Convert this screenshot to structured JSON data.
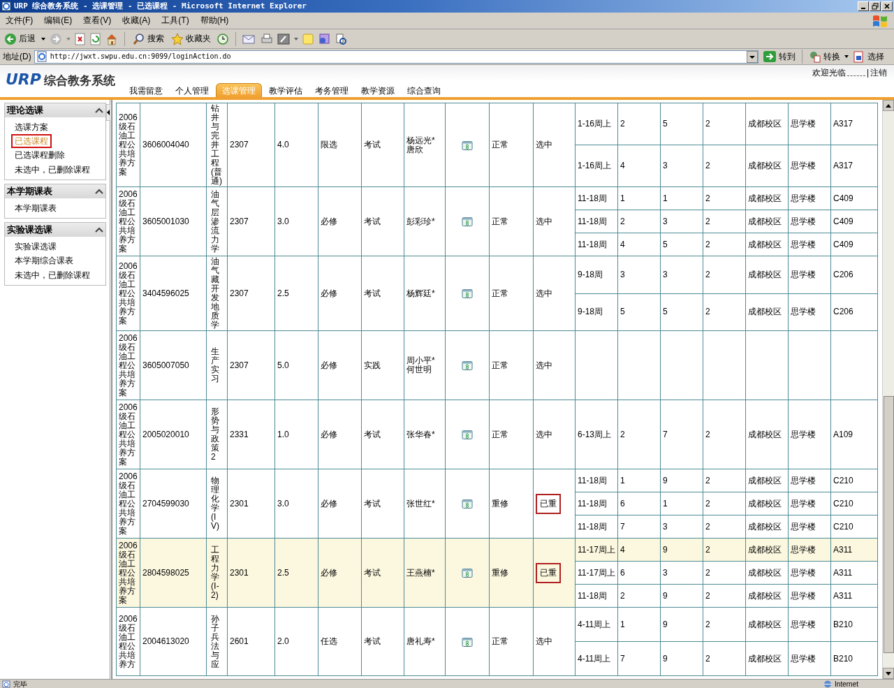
{
  "window": {
    "title": "URP 综合教务系统 - 选课管理 - 已选课程 - Microsoft Internet Explorer"
  },
  "menu": [
    "文件(F)",
    "编辑(E)",
    "查看(V)",
    "收藏(A)",
    "工具(T)",
    "帮助(H)"
  ],
  "toolbar": {
    "back": "后退",
    "search": "搜索",
    "favorites": "收藏夹"
  },
  "address_bar": {
    "label": "地址(D)",
    "url": "http://jwxt.swpu.edu.cn:9099/loginAction.do",
    "go": "转到",
    "convert": "转换",
    "select": "选择"
  },
  "header": {
    "logo_mark": "URP",
    "logo_text": "综合教务系统",
    "greeting": "欢迎光临",
    "separator": "|",
    "logout": "注销"
  },
  "tabs": [
    {
      "label": "我需留意",
      "selected": false
    },
    {
      "label": "个人管理",
      "selected": false
    },
    {
      "label": "选课管理",
      "selected": true
    },
    {
      "label": "教学评估",
      "selected": false
    },
    {
      "label": "考务管理",
      "selected": false
    },
    {
      "label": "教学资源",
      "selected": false
    },
    {
      "label": "综合查询",
      "selected": false
    }
  ],
  "sidebar": [
    {
      "title": "理论选课",
      "items": [
        {
          "label": "选课方案",
          "selected": false
        },
        {
          "label": "已选课程",
          "selected": true
        },
        {
          "label": "已选课程删除",
          "selected": false
        },
        {
          "label": "未选中，已删除课程",
          "selected": false
        }
      ]
    },
    {
      "title": "本学期课表",
      "items": [
        {
          "label": "本学期课表",
          "selected": false
        }
      ]
    },
    {
      "title": "实验课选课",
      "items": [
        {
          "label": "实验课选课",
          "selected": false
        },
        {
          "label": "本学期综合课表",
          "selected": false
        },
        {
          "label": "未选中，已删除课程",
          "selected": false
        }
      ]
    }
  ],
  "courses": [
    {
      "plan": "2006级石油工程公共培养方案",
      "code": "3606004040",
      "name": "钻井与完井工程(普通)",
      "group": "2307",
      "credit": "4.0",
      "type": "限选",
      "exam": "考试",
      "teachers": [
        "杨远光*",
        "唐欣"
      ],
      "status": "正常",
      "selection": "选中",
      "flagged": false,
      "highlighted": false,
      "sessions": [
        {
          "weeks": "1-16周上",
          "day": "2",
          "section": "5",
          "count": "2",
          "campus": "成都校区",
          "building": "思学楼",
          "room": "A317"
        },
        {
          "weeks": "1-16周上",
          "day": "4",
          "section": "3",
          "count": "2",
          "campus": "成都校区",
          "building": "思学楼",
          "room": "A317"
        }
      ]
    },
    {
      "plan": "2006级石油工程公共培养方案",
      "code": "3605001030",
      "name": "油气层渗流力学",
      "group": "2307",
      "credit": "3.0",
      "type": "必修",
      "exam": "考试",
      "teachers": [
        "彭彩珍*"
      ],
      "status": "正常",
      "selection": "选中",
      "flagged": false,
      "highlighted": false,
      "sessions": [
        {
          "weeks": "11-18周",
          "day": "1",
          "section": "1",
          "count": "2",
          "campus": "成都校区",
          "building": "思学楼",
          "room": "C409"
        },
        {
          "weeks": "11-18周",
          "day": "2",
          "section": "3",
          "count": "2",
          "campus": "成都校区",
          "building": "思学楼",
          "room": "C409"
        },
        {
          "weeks": "11-18周",
          "day": "4",
          "section": "5",
          "count": "2",
          "campus": "成都校区",
          "building": "思学楼",
          "room": "C409"
        }
      ]
    },
    {
      "plan": "2006级石油工程公共培养方案",
      "code": "3404596025",
      "name": "油气藏开发地质学",
      "group": "2307",
      "credit": "2.5",
      "type": "必修",
      "exam": "考试",
      "teachers": [
        "杨辉廷*"
      ],
      "status": "正常",
      "selection": "选中",
      "flagged": false,
      "highlighted": false,
      "sessions": [
        {
          "weeks": "9-18周",
          "day": "3",
          "section": "3",
          "count": "2",
          "campus": "成都校区",
          "building": "思学楼",
          "room": "C206"
        },
        {
          "weeks": "9-18周",
          "day": "5",
          "section": "5",
          "count": "2",
          "campus": "成都校区",
          "building": "思学楼",
          "room": "C206"
        }
      ]
    },
    {
      "plan": "2006级石油工程公共培养方案",
      "code": "3605007050",
      "name": "生产实习",
      "group": "2307",
      "credit": "5.0",
      "type": "必修",
      "exam": "实践",
      "teachers": [
        "周小平*",
        "何世明"
      ],
      "status": "正常",
      "selection": "选中",
      "flagged": false,
      "highlighted": false
    },
    {
      "plan": "2006级石油工程公共培养方案",
      "code": "2005020010",
      "name": "形势与政策2",
      "group": "2331",
      "credit": "1.0",
      "type": "必修",
      "exam": "考试",
      "teachers": [
        "张华春*"
      ],
      "status": "正常",
      "selection": "选中",
      "flagged": false,
      "highlighted": false,
      "sessions": [
        {
          "weeks": "6-13周上",
          "day": "2",
          "section": "7",
          "count": "2",
          "campus": "成都校区",
          "building": "思学楼",
          "room": "A109"
        }
      ]
    },
    {
      "plan": "2006级石油工程公共培养方案",
      "code": "2704599030",
      "name": "物理化学(IV)",
      "group": "2301",
      "credit": "3.0",
      "type": "必修",
      "exam": "考试",
      "teachers": [
        "张世红*"
      ],
      "status": "重修",
      "selection": "已重",
      "flagged": true,
      "highlighted": false,
      "sessions": [
        {
          "weeks": "11-18周",
          "day": "1",
          "section": "9",
          "count": "2",
          "campus": "成都校区",
          "building": "思学楼",
          "room": "C210"
        },
        {
          "weeks": "11-18周",
          "day": "6",
          "section": "1",
          "count": "2",
          "campus": "成都校区",
          "building": "思学楼",
          "room": "C210"
        },
        {
          "weeks": "11-18周",
          "day": "7",
          "section": "3",
          "count": "2",
          "campus": "成都校区",
          "building": "思学楼",
          "room": "C210"
        }
      ]
    },
    {
      "plan": "2006级石油工程公共培养方案",
      "code": "2804598025",
      "name": "工程力学(Ⅰ-2)",
      "group": "2301",
      "credit": "2.5",
      "type": "必修",
      "exam": "考试",
      "teachers": [
        "王燕楠*"
      ],
      "status": "重修",
      "selection": "已重",
      "flagged": true,
      "highlighted": true,
      "sessions": [
        {
          "weeks": "11-17周上",
          "day": "4",
          "section": "9",
          "count": "2",
          "campus": "成都校区",
          "building": "思学楼",
          "room": "A311"
        },
        {
          "weeks": "11-17周上",
          "day": "6",
          "section": "3",
          "count": "2",
          "campus": "成都校区",
          "building": "思学楼",
          "room": "A311"
        },
        {
          "weeks": "11-18周",
          "day": "2",
          "section": "9",
          "count": "2",
          "campus": "成都校区",
          "building": "思学楼",
          "room": "A311"
        }
      ]
    },
    {
      "plan": "2006级石油工程公共培养方",
      "code": "2004613020",
      "name": "孙子兵法与应",
      "group": "2601",
      "credit": "2.0",
      "type": "任选",
      "exam": "考试",
      "teachers": [
        "唐礼寿*"
      ],
      "status": "正常",
      "selection": "选中",
      "flagged": false,
      "highlighted": false,
      "sessions": [
        {
          "weeks": "4-11周上",
          "day": "1",
          "section": "9",
          "count": "2",
          "campus": "成都校区",
          "building": "思学楼",
          "room": "B210"
        },
        {
          "weeks": "4-11周上",
          "day": "7",
          "section": "9",
          "count": "2",
          "campus": "成都校区",
          "building": "思学楼",
          "room": "B210"
        }
      ]
    }
  ],
  "status_bar": {
    "text": "完毕",
    "zone": "Internet"
  }
}
